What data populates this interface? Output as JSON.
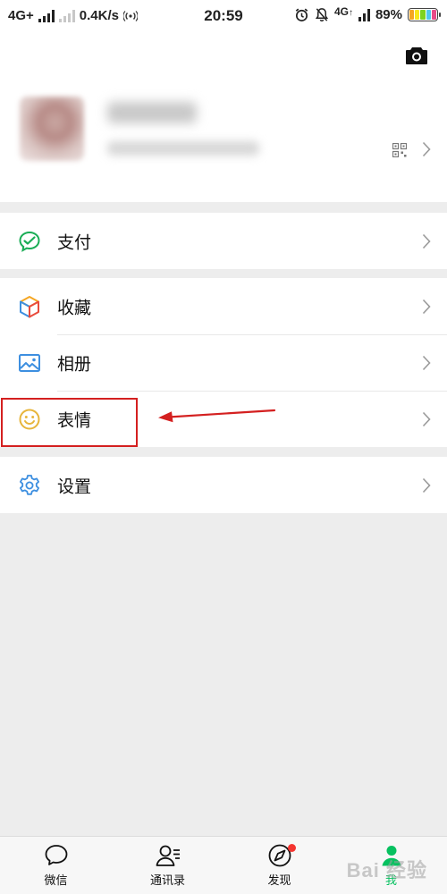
{
  "status_bar": {
    "network": "4G+",
    "speed": "0.4K/s",
    "hotspot_icon": "hotspot-icon",
    "time": "20:59",
    "network_right": "4G",
    "battery_percent": "89%",
    "battery_level": 0.89
  },
  "menu": {
    "pay_label": "支付",
    "favorites_label": "收藏",
    "album_label": "相册",
    "stickers_label": "表情",
    "settings_label": "设置"
  },
  "tabs": [
    {
      "label": "微信",
      "icon": "chat-bubble-icon",
      "active": false
    },
    {
      "label": "通讯录",
      "icon": "contacts-icon",
      "active": false
    },
    {
      "label": "发现",
      "icon": "compass-icon",
      "active": false,
      "badge": true
    },
    {
      "label": "我",
      "icon": "person-icon",
      "active": true
    }
  ],
  "watermark": "Bai 经验",
  "colors": {
    "brand_green": "#07c160",
    "annotation_red": "#d42020",
    "badge_red": "#f43530"
  }
}
